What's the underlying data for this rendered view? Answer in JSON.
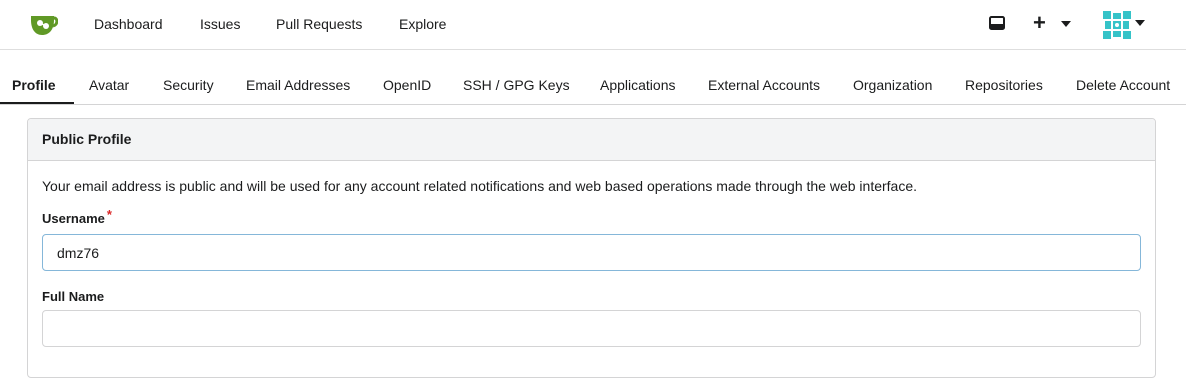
{
  "topnav": {
    "items": [
      "Dashboard",
      "Issues",
      "Pull Requests",
      "Explore"
    ],
    "icons": [
      "logo-icon",
      "inbox-icon",
      "plus-icon",
      "avatar-icon"
    ]
  },
  "tabs": {
    "items": [
      "Profile",
      "Avatar",
      "Security",
      "Email Addresses",
      "OpenID",
      "SSH / GPG Keys",
      "Applications",
      "External Accounts",
      "Organization",
      "Repositories",
      "Delete Account"
    ],
    "active": "Profile"
  },
  "profile": {
    "title": "Public Profile",
    "info": "Your email address is public and will be used for any account related notifications and web based operations made through the web interface.",
    "username_label": "Username",
    "required_marker": "*",
    "username_value": "dmz76",
    "fullname_label": "Full Name",
    "fullname_value": ""
  },
  "colors": {
    "brand": "#609926",
    "required": "#db2828",
    "focus_border": "#85b7d9"
  }
}
